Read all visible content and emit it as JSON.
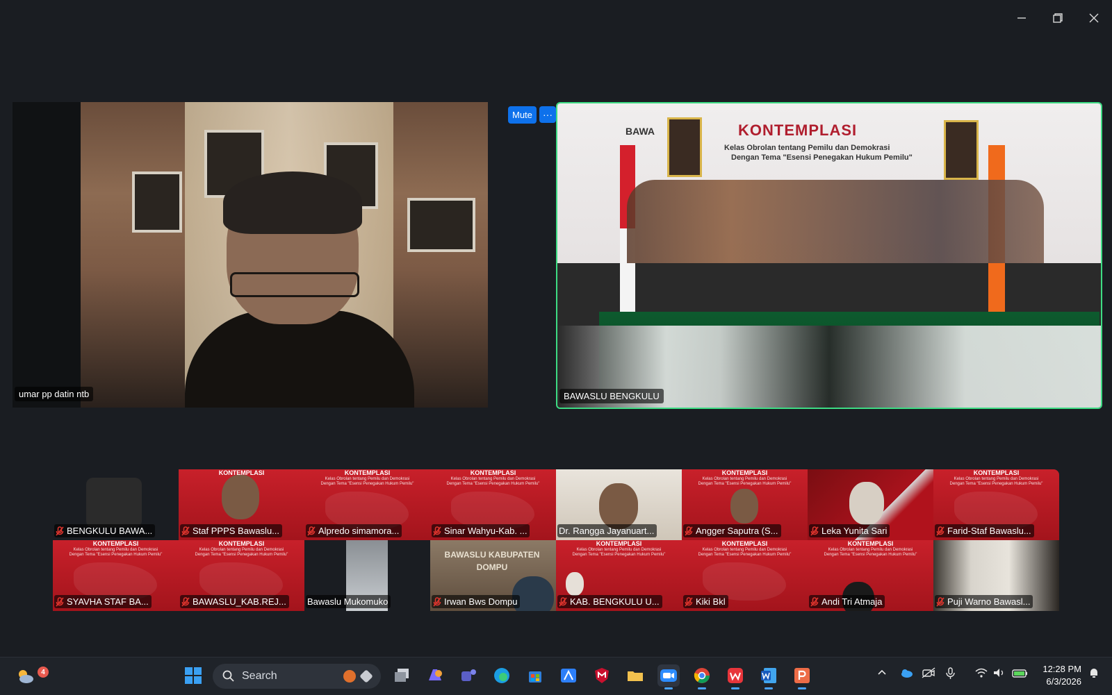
{
  "window_controls": {
    "minimize_icon": "minimize-icon",
    "restore_icon": "restore-icon",
    "close_icon": "close-icon"
  },
  "main_speakers": {
    "left": {
      "name": "umar pp datin ntb"
    },
    "right": {
      "name": "BAWASLU BENGKULU",
      "banner_title": "KONTEMPLASI",
      "banner_line1": "Kelas Obrolan tentang Pemilu dan Demokrasi",
      "banner_line2": "Dengan Tema \"Esensi Penegakan Hukum Pemilu\"",
      "brand": "BAWA"
    },
    "mute_label": "Mute",
    "more_label": "···"
  },
  "gallery_banner": {
    "title": "KONTEMPLASI",
    "line1": "Kelas Obrolan tentang Pemilu dan Demokrasi",
    "line2": "Dengan Tema \"Esensi Penegakan Hukum Pemilu\""
  },
  "gallery": {
    "row1": [
      {
        "name": "BENGKULU BAWA...",
        "muted": true
      },
      {
        "name": "Staf PPPS Bawaslu...",
        "muted": true
      },
      {
        "name": "Alpredo simamora...",
        "muted": true
      },
      {
        "name": "Sinar Wahyu-Kab. ...",
        "muted": true
      },
      {
        "name": "Dr. Rangga Jayanuart...",
        "muted": false
      },
      {
        "name": "Angger Saputra (S...",
        "muted": true
      },
      {
        "name": "Leka Yunita Sari",
        "muted": true
      },
      {
        "name": "Farid-Staf Bawaslu...",
        "muted": true
      }
    ],
    "row2": [
      {
        "name": "SYAVHA STAF BA...",
        "muted": true
      },
      {
        "name": "BAWASLU_KAB.REJ...",
        "muted": true
      },
      {
        "name": "Bawaslu Mukomuko",
        "muted": false
      },
      {
        "name": "Irwan Bws Dompu",
        "muted": true
      },
      {
        "name": "KAB. BENGKULU U...",
        "muted": true
      },
      {
        "name": "Kiki Bkl",
        "muted": true
      },
      {
        "name": "Andi Tri Atmaja",
        "muted": true
      },
      {
        "name": "Puji Warno Bawasl...",
        "muted": true
      }
    ],
    "dompu_sign": "BAWASLU KABUPATEN DOMPU"
  },
  "taskbar": {
    "weather_badge": "4",
    "search_placeholder": "Search",
    "time": "12:28 PM",
    "date": "6/3/2026"
  }
}
